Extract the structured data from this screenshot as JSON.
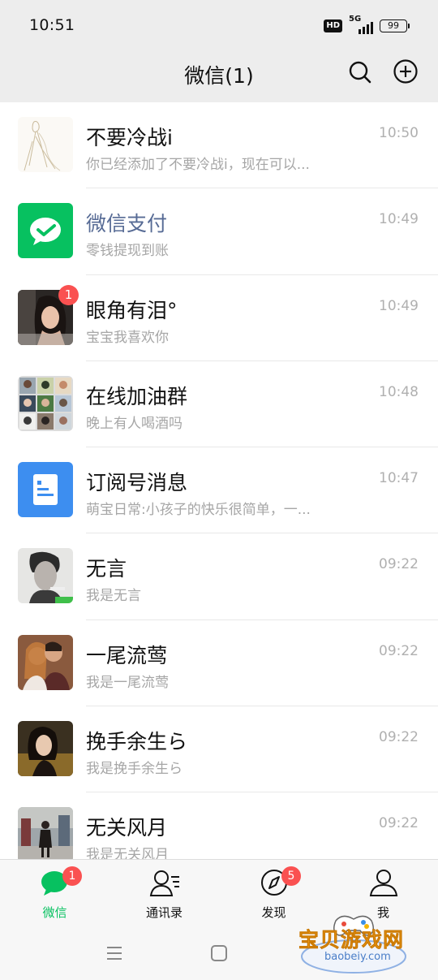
{
  "status_bar": {
    "time": "10:51",
    "hd": "HD",
    "network": "5G",
    "battery": "99"
  },
  "header": {
    "title": "微信(1)"
  },
  "chats": [
    {
      "name": "不要冷战i",
      "preview": "你已经添加了不要冷战i，现在可以...",
      "time": "10:50",
      "avatar": "sketch-avatar"
    },
    {
      "name": "微信支付",
      "preview": "零钱提现到账",
      "time": "10:49",
      "avatar": "wechat-pay-icon",
      "service": true
    },
    {
      "name": "眼角有泪°",
      "preview": "宝宝我喜欢你",
      "time": "10:49",
      "avatar": "girl-photo-avatar",
      "unread": "1"
    },
    {
      "name": "在线加油群",
      "preview": "晚上有人喝酒吗",
      "time": "10:48",
      "avatar": "group-grid-avatar"
    },
    {
      "name": "订阅号消息",
      "preview": "萌宝日常:小孩子的快乐很简单，一...",
      "time": "10:47",
      "avatar": "subscription-doc-icon"
    },
    {
      "name": "无言",
      "preview": "我是无言",
      "time": "09:22",
      "avatar": "man-smoking-avatar"
    },
    {
      "name": "一尾流莺",
      "preview": "我是一尾流莺",
      "time": "09:22",
      "avatar": "couple-photo-avatar"
    },
    {
      "name": "挽手余生ら",
      "preview": "我是挽手余生ら",
      "time": "09:22",
      "avatar": "woman-portrait-avatar"
    },
    {
      "name": "无关风月",
      "preview": "我是无关风月",
      "time": "09:22",
      "avatar": "street-photo-avatar"
    }
  ],
  "tabs": [
    {
      "label": "微信",
      "icon": "chat-bubble-icon",
      "badge": "1",
      "active": true
    },
    {
      "label": "通讯录",
      "icon": "contacts-icon"
    },
    {
      "label": "发现",
      "icon": "compass-icon",
      "badge": "5"
    },
    {
      "label": "我",
      "icon": "person-icon"
    }
  ],
  "watermark": {
    "title": "宝贝游戏网",
    "url": "baobeiy.com"
  },
  "colors": {
    "accent": "#07c160",
    "badge": "#fa5151",
    "service_name": "#576b95",
    "doc_blue": "#3d8ef0"
  }
}
